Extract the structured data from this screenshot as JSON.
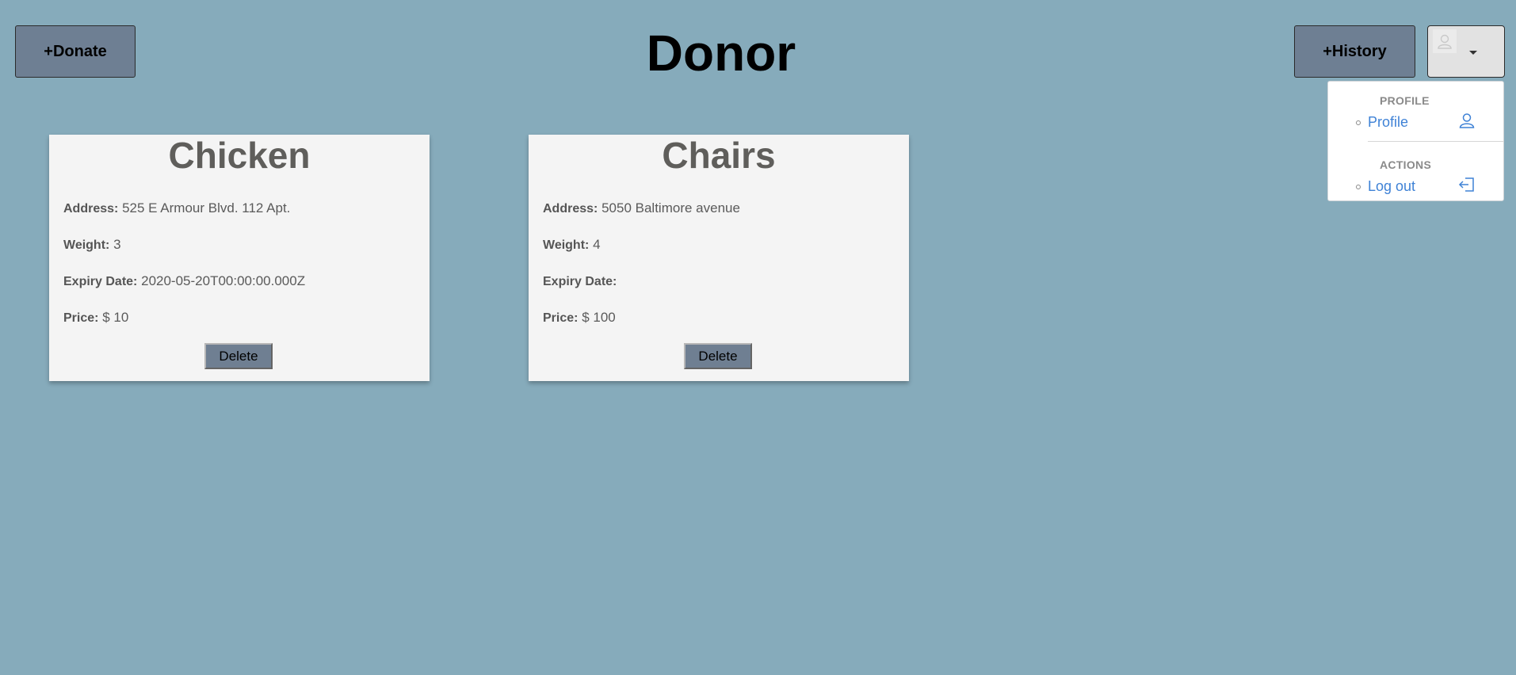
{
  "header": {
    "title": "Donor",
    "donate_label": "+Donate",
    "history_label": "+History"
  },
  "user_menu": {
    "profile_heading": "PROFILE",
    "profile_label": "Profile",
    "actions_heading": "ACTIONS",
    "logout_label": "Log out"
  },
  "labels": {
    "address": "Address:",
    "weight": "Weight:",
    "expiry": "Expiry Date:",
    "price": "Price:",
    "delete": "Delete"
  },
  "cards": [
    {
      "title": "Chicken",
      "address": "525 E Armour Blvd. 112 Apt.",
      "weight": "3",
      "expiry": "2020-05-20T00:00:00.000Z",
      "price": "$ 10"
    },
    {
      "title": "Chairs",
      "address": "5050 Baltimore avenue",
      "weight": "4",
      "expiry": "",
      "price": "$ 100"
    }
  ],
  "colors": {
    "background": "#86abbb",
    "button": "#6e7f93",
    "link": "#3f82d6"
  }
}
